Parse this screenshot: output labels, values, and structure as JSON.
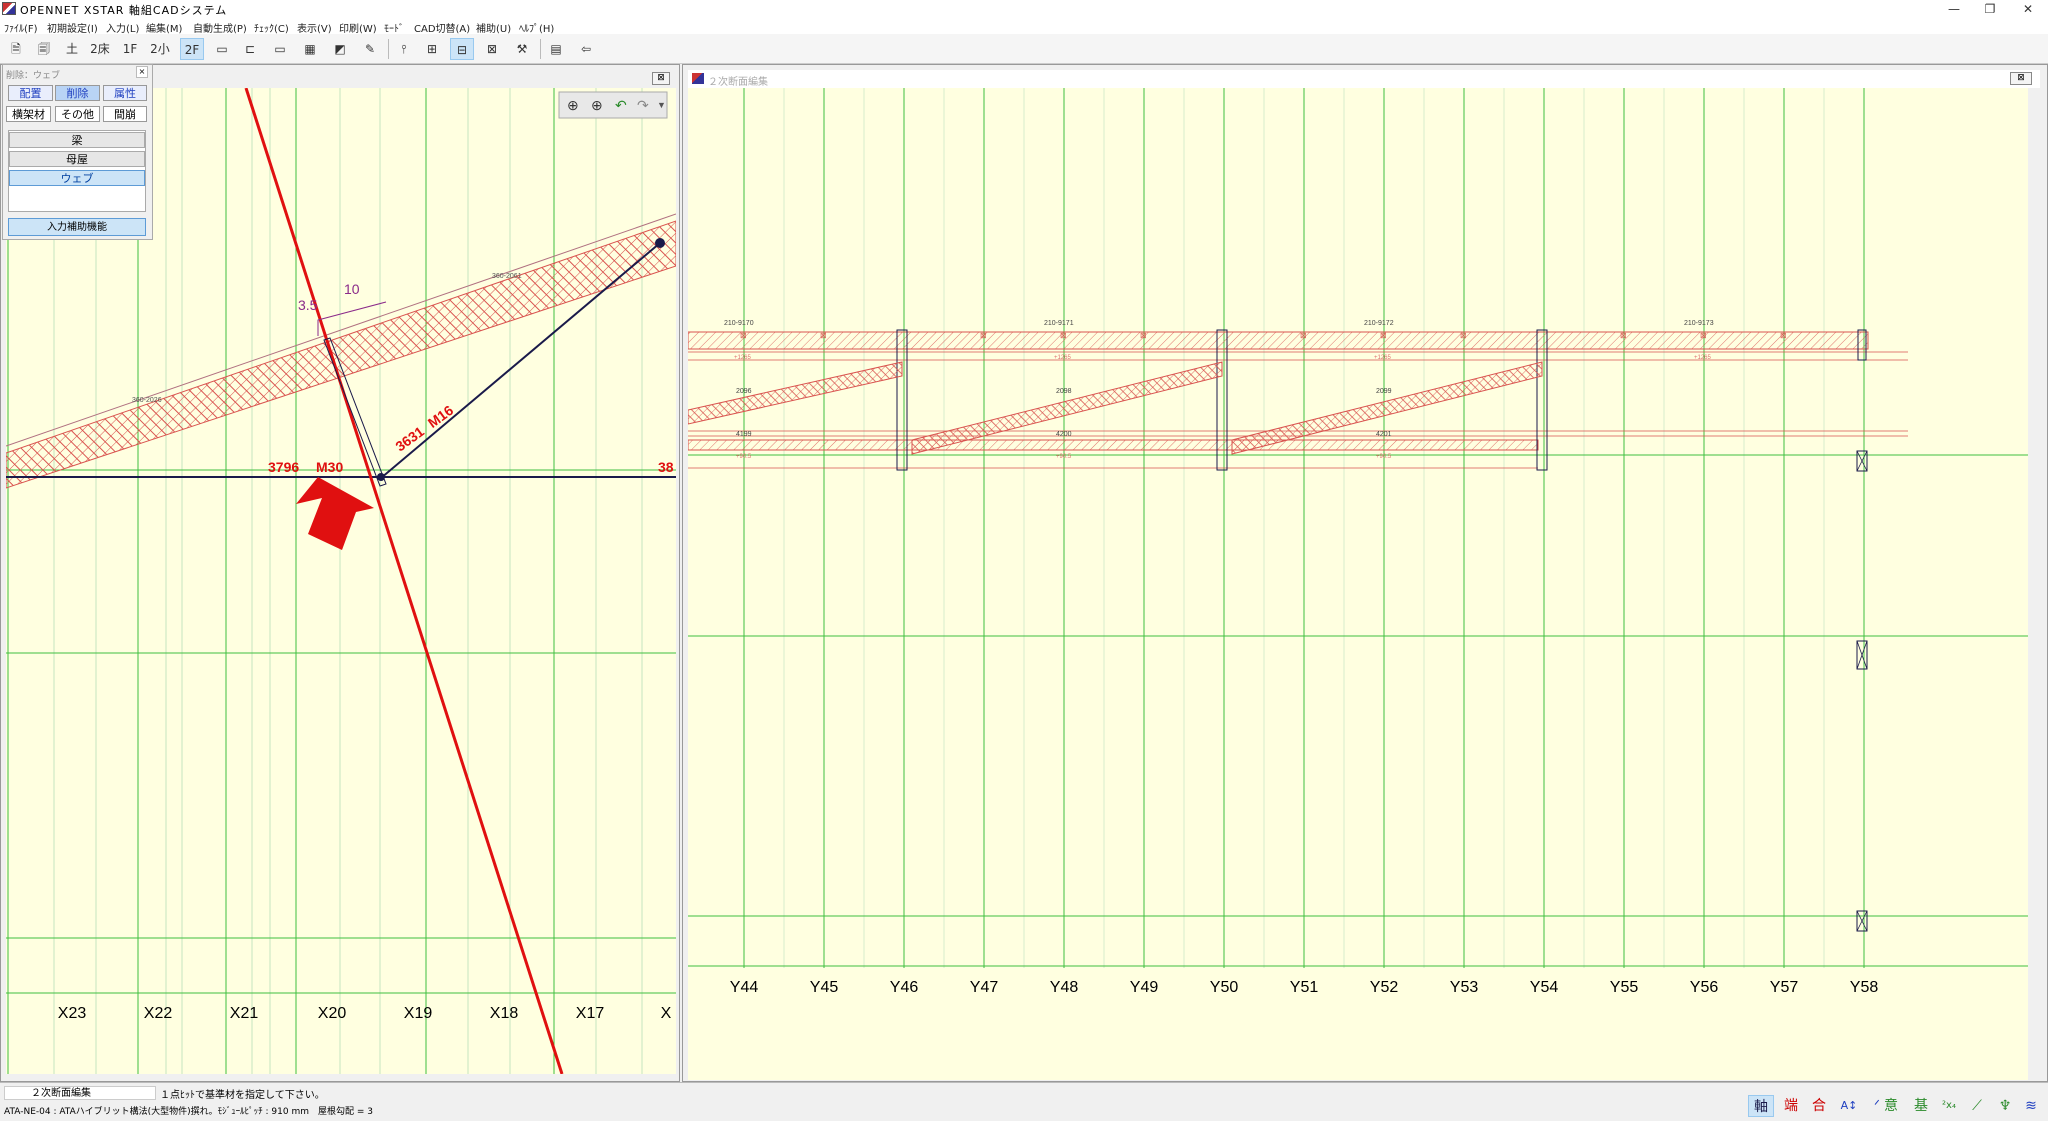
{
  "window": {
    "title": "OPENNET XSTAR 軸組CADシステム",
    "minimize": "—",
    "restore": "❐",
    "close": "✕"
  },
  "menu": [
    "ﾌｧｲﾙ(F)",
    "初期設定(I)",
    "入力(L)",
    "編集(M)",
    "自動生成(P)",
    "ﾁｪｯｸ(C)",
    "表示(V)",
    "印刷(W)",
    "ﾓｰﾄﾞ",
    "CAD切替(A)",
    "補助(U)",
    "ﾍﾙﾌﾟ(H)"
  ],
  "toolbar": {
    "floor_buttons": [
      "土",
      "2床",
      "1F",
      "2小",
      "2F"
    ]
  },
  "float_panel": {
    "title": "削除：ウェブ",
    "close": "×",
    "tabs_row1": [
      "配置",
      "削除",
      "属性"
    ],
    "tabs_row2": [
      "横架材",
      "その他",
      "間崩"
    ],
    "items": [
      "梁",
      "母屋",
      "ウェブ"
    ],
    "assist_button": "入力補助機能"
  },
  "left_view": {
    "close": "⊠",
    "x_axis_labels": [
      "X23",
      "X22",
      "X21",
      "X20",
      "X19",
      "X18",
      "X17",
      "X"
    ],
    "annotations": {
      "slope_run": "10",
      "slope_rise": "3.5",
      "member_a": "3796",
      "member_a_size": "M30",
      "member_b": "3631",
      "member_b_size": "M16",
      "member_c": "38",
      "beam_label_top": "360-2061",
      "beam_label_left": "360-2026"
    }
  },
  "right_view": {
    "title": "２次断面編集",
    "close": "⊠",
    "y_axis_labels": [
      "Y44",
      "Y45",
      "Y46",
      "Y47",
      "Y48",
      "Y49",
      "Y50",
      "Y51",
      "Y52",
      "Y53",
      "Y54",
      "Y55",
      "Y56",
      "Y57",
      "Y58"
    ],
    "top_beam_labels": [
      "210-9170",
      "210-9171",
      "210-9172",
      "210-9173"
    ],
    "top_beam_sublabels": [
      "+1265",
      "+1265",
      "+1265",
      "+1265"
    ],
    "web_labels": [
      "2096",
      "2098",
      "2099"
    ],
    "bottom_beam_labels": [
      "4199",
      "4200",
      "4201"
    ],
    "bottom_beam_sublabels": [
      "+90.5",
      "+90.5",
      "+90.5"
    ]
  },
  "status": {
    "pane": "２次断面編集",
    "message": "１点ﾋｯﾄで基準材を指定して下さい。",
    "info": "ATA-NE-04 : ATAハイブリット構法(大型物件)撰れ。ﾓｼﾞｭｰﾙﾋﾟｯﾁ : 910 mm　屋根勾配 = 3"
  },
  "status_icons": [
    "軸",
    "端",
    "合",
    "A↕",
    "ᐟ",
    "意",
    "基",
    "²x₄",
    "⟋",
    "♆",
    "≋"
  ],
  "colors": {
    "canvas": "#ffffe0",
    "grid_green": "#3fbf3f",
    "member_red": "#e01010",
    "hatch_red": "#d9534f",
    "accent_blue": "#2040c0"
  }
}
